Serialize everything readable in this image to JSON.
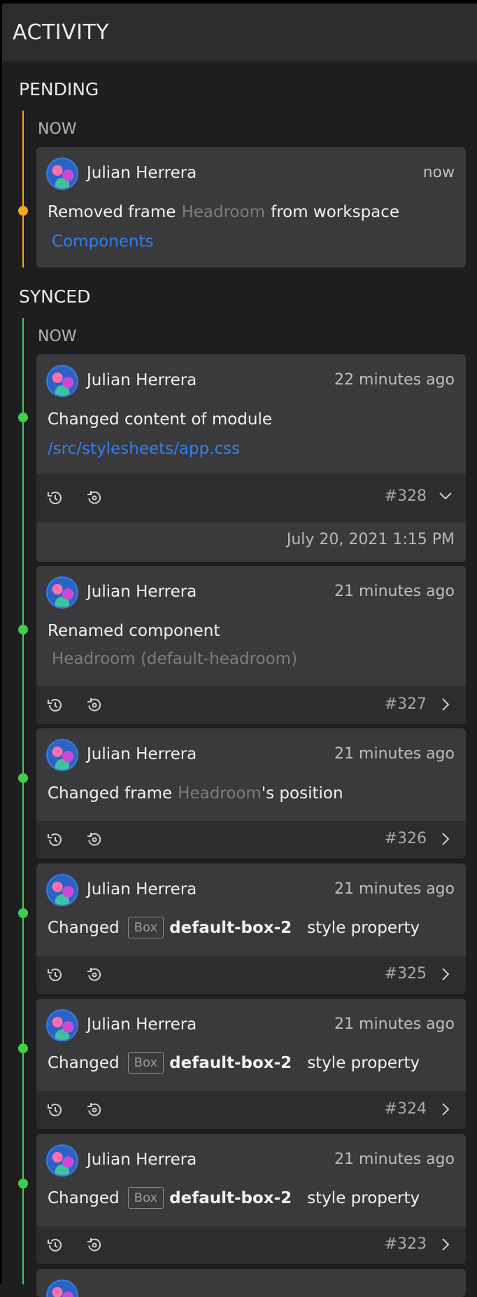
{
  "header": {
    "title": "ACTIVITY"
  },
  "pending": {
    "title": "PENDING",
    "group": "NOW",
    "item": {
      "user": "Julian Herrera",
      "time": "now",
      "prefix": "Removed frame",
      "frame": "Headroom",
      "suffix": "from workspace",
      "workspace": "Components"
    }
  },
  "synced": {
    "title": "SYNCED",
    "group": "NOW",
    "items": [
      {
        "user": "Julian Herrera",
        "time": "22 minutes ago",
        "text": "Changed content of module",
        "link": "/src/stylesheets/app.css",
        "rev": "#328",
        "date": "July 20, 2021 1:15 PM"
      },
      {
        "user": "Julian Herrera",
        "time": "21 minutes ago",
        "text": "Renamed component",
        "detail": "Headroom (default-headroom)",
        "rev": "#327"
      },
      {
        "user": "Julian Herrera",
        "time": "21 minutes ago",
        "prefix": "Changed frame",
        "frame": "Headroom",
        "suffix": "'s position",
        "rev": "#326"
      },
      {
        "user": "Julian Herrera",
        "time": "21 minutes ago",
        "prefix": "Changed",
        "badge": "Box",
        "name": "default-box-2",
        "suffix": "style property",
        "rev": "#325"
      },
      {
        "user": "Julian Herrera",
        "time": "21 minutes ago",
        "prefix": "Changed",
        "badge": "Box",
        "name": "default-box-2",
        "suffix": "style property",
        "rev": "#324"
      },
      {
        "user": "Julian Herrera",
        "time": "21 minutes ago",
        "prefix": "Changed",
        "badge": "Box",
        "name": "default-box-2",
        "suffix": "style property",
        "rev": "#323"
      }
    ]
  },
  "colors": {
    "pending": "#f5a623",
    "synced": "#3ecf4a",
    "link": "#2f7ff2"
  },
  "icons": {
    "restore": "history-icon",
    "revert": "revert-icon",
    "expanded": "chevron-down-icon",
    "collapsed": "chevron-right-icon"
  }
}
